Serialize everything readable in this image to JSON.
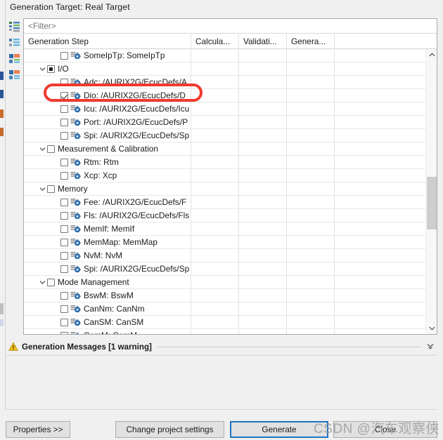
{
  "dialog": {
    "title": "Generation Target: Real Target"
  },
  "toolbar": {
    "buttons": [
      {
        "name": "expand-all-icon",
        "tooltip": "Expand All"
      },
      {
        "name": "collapse-all-icon",
        "tooltip": "Collapse All"
      },
      {
        "name": "select-all-icon",
        "tooltip": "Select All"
      },
      {
        "name": "deselect-all-icon",
        "tooltip": "Deselect All"
      }
    ]
  },
  "filter": {
    "placeholder": "<Filter>",
    "value": ""
  },
  "table": {
    "columns": [
      "Generation Step",
      "Calcula...",
      "Validati...",
      "Genera...",
      ""
    ],
    "rows": [
      {
        "label": "SomeIpTp: SomeIpTp",
        "level": "leaf",
        "checked": "unchecked",
        "twisty": "none",
        "icon": "module-icon"
      },
      {
        "label": "I/O",
        "level": "group",
        "checked": "partial",
        "twisty": "expanded",
        "icon": "none"
      },
      {
        "label": "Adc: /AURIX2G/EcucDefs/A",
        "level": "leaf",
        "checked": "unchecked",
        "twisty": "none",
        "icon": "module-icon"
      },
      {
        "label": "Dio: /AURIX2G/EcucDefs/D",
        "level": "leaf",
        "checked": "checked",
        "twisty": "none",
        "icon": "module-icon"
      },
      {
        "label": "Icu: /AURIX2G/EcucDefs/Icu",
        "level": "leaf",
        "checked": "unchecked",
        "twisty": "none",
        "icon": "module-icon"
      },
      {
        "label": "Port: /AURIX2G/EcucDefs/P",
        "level": "leaf",
        "checked": "unchecked",
        "twisty": "none",
        "icon": "module-icon"
      },
      {
        "label": "Spi: /AURIX2G/EcucDefs/Sp",
        "level": "leaf",
        "checked": "unchecked",
        "twisty": "none",
        "icon": "module-icon"
      },
      {
        "label": "Measurement & Calibration",
        "level": "group",
        "checked": "unchecked",
        "twisty": "expanded",
        "icon": "none"
      },
      {
        "label": "Rtm: Rtm",
        "level": "leaf",
        "checked": "unchecked",
        "twisty": "none",
        "icon": "module-icon"
      },
      {
        "label": "Xcp: Xcp",
        "level": "leaf",
        "checked": "unchecked",
        "twisty": "none",
        "icon": "module-icon"
      },
      {
        "label": "Memory",
        "level": "group",
        "checked": "unchecked",
        "twisty": "expanded",
        "icon": "none"
      },
      {
        "label": "Fee: /AURIX2G/EcucDefs/F",
        "level": "leaf",
        "checked": "unchecked",
        "twisty": "none",
        "icon": "module-icon"
      },
      {
        "label": "Fls: /AURIX2G/EcucDefs/Fls",
        "level": "leaf",
        "checked": "unchecked",
        "twisty": "none",
        "icon": "module-icon"
      },
      {
        "label": "MemIf: MemIf",
        "level": "leaf",
        "checked": "unchecked",
        "twisty": "none",
        "icon": "module-icon"
      },
      {
        "label": "MemMap: MemMap",
        "level": "leaf",
        "checked": "unchecked",
        "twisty": "none",
        "icon": "module-icon"
      },
      {
        "label": "NvM: NvM",
        "level": "leaf",
        "checked": "unchecked",
        "twisty": "none",
        "icon": "module-icon"
      },
      {
        "label": "Spi: /AURIX2G/EcucDefs/Sp",
        "level": "leaf",
        "checked": "unchecked",
        "twisty": "none",
        "icon": "module-icon"
      },
      {
        "label": "Mode Management",
        "level": "group",
        "checked": "unchecked",
        "twisty": "expanded",
        "icon": "none"
      },
      {
        "label": "BswM: BswM",
        "level": "leaf",
        "checked": "unchecked",
        "twisty": "none",
        "icon": "module-icon"
      },
      {
        "label": "CanNm: CanNm",
        "level": "leaf",
        "checked": "unchecked",
        "twisty": "none",
        "icon": "module-icon"
      },
      {
        "label": "CanSM: CanSM",
        "level": "leaf",
        "checked": "unchecked",
        "twisty": "none",
        "icon": "module-icon"
      },
      {
        "label": "ComM: ComM",
        "level": "leaf",
        "checked": "unchecked",
        "twisty": "none",
        "icon": "module-icon"
      }
    ]
  },
  "messages": {
    "header": "Generation Messages [1 warning]",
    "warning_color": "#f0c020"
  },
  "buttons": {
    "properties": "Properties >>",
    "change_project_settings": "Change project settings",
    "generate": "Generate",
    "close": "Close"
  },
  "watermark": {
    "text": "CSDN @汽车观察侠"
  },
  "annotation": {
    "highlight_color": "#f03a2e",
    "target_row": "Dio: /AURIX2G/EcucDefs/D"
  }
}
